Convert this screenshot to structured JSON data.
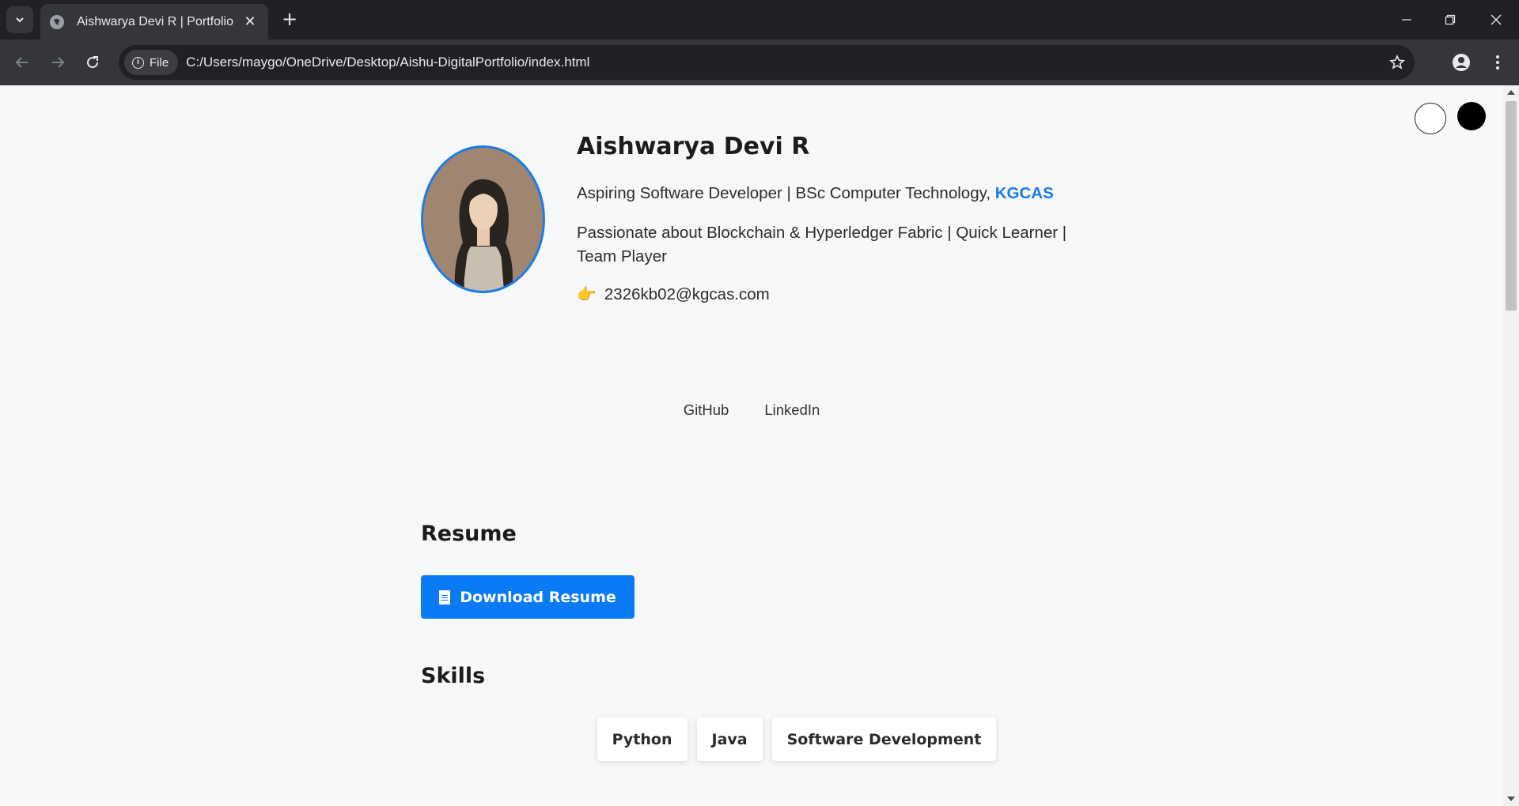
{
  "browser": {
    "tab_title": "Aishwarya Devi R | Portfolio",
    "new_tab": "+",
    "scheme_chip": "File",
    "url": "C:/Users/maygo/OneDrive/Desktop/Aishu-DigitalPortfolio/index.html"
  },
  "profile": {
    "name": "Aishwarya Devi R",
    "tagline": "Aspiring Software Developer | BSc Computer Technology, ",
    "college": "KGCAS",
    "passion": "Passionate about Blockchain & Hyperledger Fabric | Quick Learner | Team Player",
    "email_emoji": "👉",
    "email": "2326kb02@kgcas.com"
  },
  "social": {
    "github": "GitHub",
    "linkedin": "LinkedIn"
  },
  "resume": {
    "title": "Resume",
    "button": "Download Resume"
  },
  "skills": {
    "title": "Skills",
    "items": [
      "Python",
      "Java",
      "Software Development"
    ]
  },
  "colors": {
    "accent": "#0a7af5",
    "page_bg": "#f7f8fa",
    "chrome_bg": "#202124"
  }
}
